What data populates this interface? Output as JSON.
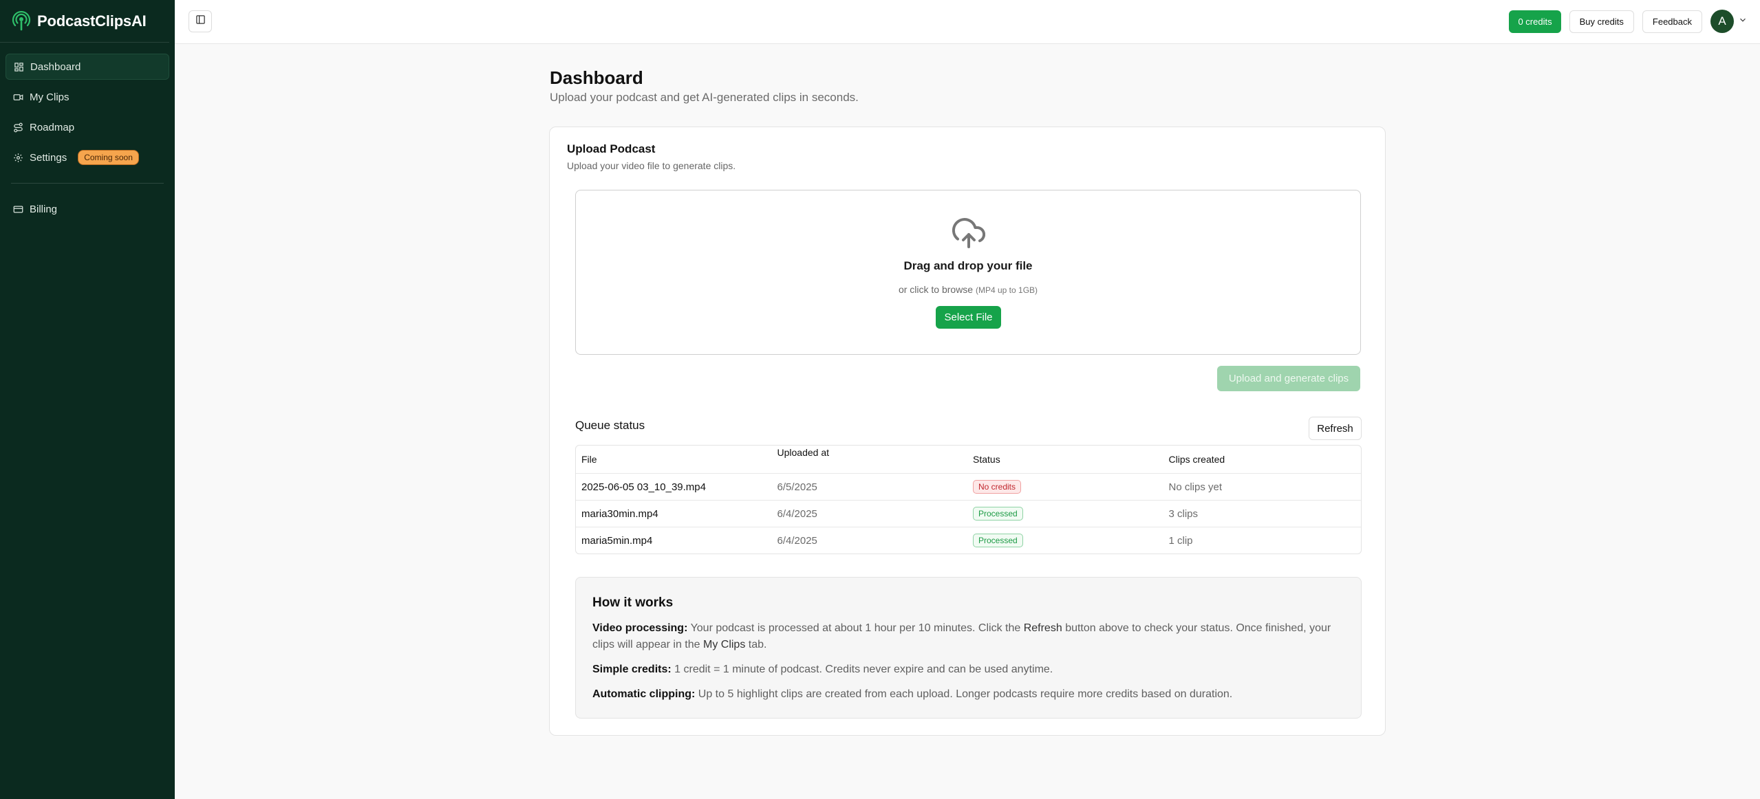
{
  "brand": {
    "name": "PodcastClipsAI"
  },
  "sidebar": {
    "items": [
      {
        "label": "Dashboard",
        "icon": "dashboard-icon"
      },
      {
        "label": "My Clips",
        "icon": "video-icon"
      },
      {
        "label": "Roadmap",
        "icon": "roadmap-icon"
      },
      {
        "label": "Settings",
        "icon": "gear-icon",
        "badge": "Coming soon"
      }
    ],
    "billing": {
      "label": "Billing",
      "icon": "credit-card-icon"
    }
  },
  "header": {
    "credits": "0 credits",
    "buy_credits": "Buy credits",
    "feedback": "Feedback",
    "avatar_initial": "A"
  },
  "page": {
    "title": "Dashboard",
    "subtitle": "Upload your podcast and get AI-generated clips in seconds."
  },
  "upload": {
    "title": "Upload Podcast",
    "subtitle": "Upload your video file to generate clips.",
    "drop_title": "Drag and drop your file",
    "drop_sub": "or click to browse",
    "drop_hint": "(MP4 up to 1GB)",
    "select_file": "Select File",
    "submit": "Upload and generate clips"
  },
  "queue": {
    "title": "Queue status",
    "refresh": "Refresh",
    "columns": [
      "File",
      "Uploaded at",
      "Status",
      "Clips created"
    ],
    "rows": [
      {
        "file": "2025-06-05 03_10_39.mp4",
        "uploaded": "6/5/2025",
        "status": "No credits",
        "clips": "No clips yet"
      },
      {
        "file": "maria30min.mp4",
        "uploaded": "6/4/2025",
        "status": "Processed",
        "clips": "3 clips"
      },
      {
        "file": "maria5min.mp4",
        "uploaded": "6/4/2025",
        "status": "Processed",
        "clips": "1 clip"
      }
    ]
  },
  "how": {
    "title": "How it works",
    "p1_label": "Video processing:",
    "p1_a": "Your podcast is processed at about 1 hour per 10 minutes. Click the",
    "p1_refresh": "Refresh",
    "p1_b": "button above to check your status. Once finished, your clips will appear in the",
    "p1_tab": "My Clips",
    "p1_c": "tab.",
    "p2_label": "Simple credits:",
    "p2": "1 credit = 1 minute of podcast. Credits never expire and can be used anytime.",
    "p3_label": "Automatic clipping:",
    "p3": "Up to 5 highlight clips are created from each upload. Longer podcasts require more credits based on duration."
  },
  "colors": {
    "sidebar_bg": "#0b2a1f",
    "accent": "#16a34a",
    "badge": "#f6a54d"
  }
}
